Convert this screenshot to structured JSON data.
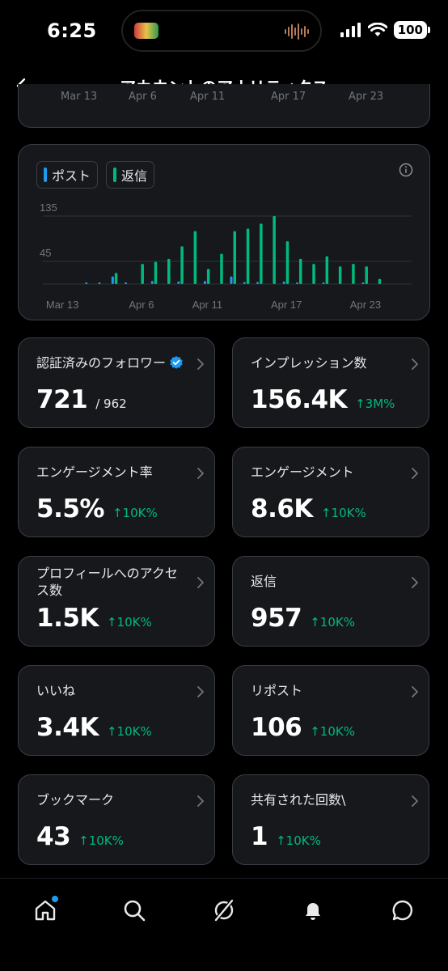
{
  "status_bar": {
    "time": "6:25",
    "battery": "100"
  },
  "header": {
    "title": "アカウントのアナリティクス",
    "back_icon": "arrow-left-icon"
  },
  "clipped_card": {
    "ticks": [
      "Mar 13",
      "Apr 6",
      "Apr 11",
      "Apr 17",
      "Apr 23"
    ]
  },
  "chart": {
    "legend": [
      {
        "label": "ポスト",
        "color": "#1d9bf0"
      },
      {
        "label": "返信",
        "color": "#00ba7c"
      }
    ],
    "info_icon": "info-icon"
  },
  "chart_data": {
    "type": "bar",
    "title": "",
    "xlabel": "",
    "ylabel": "",
    "ylim": [
      0,
      135
    ],
    "y_ticks": [
      45,
      135
    ],
    "x_tick_labels": [
      "Mar 13",
      "Apr 6",
      "Apr 11",
      "Apr 17",
      "Apr 23"
    ],
    "x_tick_days": [
      1,
      7,
      12,
      18,
      24
    ],
    "days": [
      1,
      2,
      3,
      4,
      5,
      6,
      7,
      8,
      9,
      10,
      11,
      12,
      13,
      14,
      15,
      16,
      17,
      18,
      19,
      20,
      21,
      22,
      23,
      24,
      25,
      26,
      27
    ],
    "series": [
      {
        "name": "ポスト",
        "values": [
          0,
          0,
          1,
          1,
          15,
          3,
          0,
          6,
          0,
          5,
          0,
          6,
          0,
          15,
          4,
          4,
          0,
          5,
          2,
          0,
          2,
          0,
          0,
          2,
          0,
          0,
          0
        ]
      },
      {
        "name": "返信",
        "values": [
          0,
          0,
          0,
          0,
          22,
          0,
          40,
          44,
          50,
          75,
          105,
          30,
          60,
          105,
          110,
          120,
          135,
          85,
          50,
          40,
          55,
          35,
          40,
          35,
          10,
          0,
          0
        ]
      }
    ]
  },
  "metrics": [
    {
      "label": "認証済みのフォロワー",
      "verified": true,
      "value": "721",
      "sub": "/ 962",
      "delta": ""
    },
    {
      "label": "インプレッション数",
      "value": "156.4K",
      "sub": "",
      "delta": "↑3M%"
    },
    {
      "label": "エンゲージメント率",
      "value": "5.5%",
      "sub": "",
      "delta": "↑10K%"
    },
    {
      "label": "エンゲージメント",
      "value": "8.6K",
      "sub": "",
      "delta": "↑10K%"
    },
    {
      "label": "プロフィールへのアクセス数",
      "value": "1.5K",
      "sub": "",
      "delta": "↑10K%"
    },
    {
      "label": "返信",
      "value": "957",
      "sub": "",
      "delta": "↑10K%"
    },
    {
      "label": "いいね",
      "value": "3.4K",
      "sub": "",
      "delta": "↑10K%"
    },
    {
      "label": "リポスト",
      "value": "106",
      "sub": "",
      "delta": "↑10K%"
    },
    {
      "label": "ブックマーク",
      "value": "43",
      "sub": "",
      "delta": "↑10K%"
    },
    {
      "label": "共有された回数\\",
      "value": "1",
      "sub": "",
      "delta": "↑10K%"
    }
  ],
  "bottom_nav": [
    {
      "icon": "home-icon",
      "badge": true
    },
    {
      "icon": "search-icon",
      "badge": false
    },
    {
      "icon": "grok-icon",
      "badge": false
    },
    {
      "icon": "bell-icon",
      "badge": false
    },
    {
      "icon": "messages-icon",
      "badge": false
    }
  ],
  "colors": {
    "accent_blue": "#1d9bf0",
    "accent_green": "#00ba7c",
    "card_bg": "#16181c",
    "card_border": "#3a3e44"
  }
}
